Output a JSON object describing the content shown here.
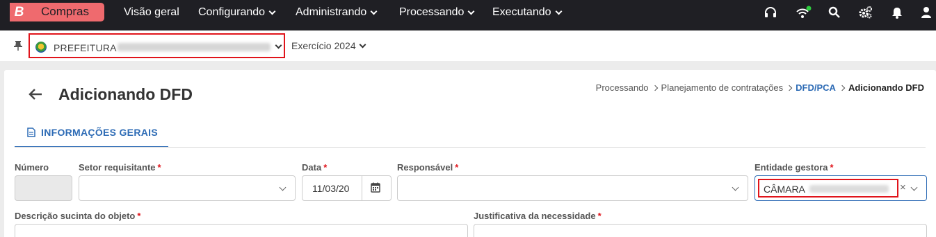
{
  "nav": {
    "brand_letter": "B",
    "brand_name": "Compras",
    "items": [
      {
        "label": "Visão geral"
      },
      {
        "label": "Configurando"
      },
      {
        "label": "Administrando"
      },
      {
        "label": "Processando"
      },
      {
        "label": "Executando"
      }
    ],
    "icons": [
      "headset-icon",
      "wifi-icon",
      "search-icon",
      "gears-icon",
      "bell-icon",
      "user-icon"
    ],
    "status_color": "#2ecc40"
  },
  "context": {
    "entity_label": "PREFEITURA",
    "exercise_label": "Exercício 2024"
  },
  "page": {
    "title": "Adicionando DFD",
    "breadcrumb": [
      "Processando",
      "Planejamento de contratações",
      "DFD/PCA",
      "Adicionando DFD"
    ],
    "tab_label": "INFORMAÇÕES GERAIS"
  },
  "form": {
    "numero_label": "Número",
    "setor_label": "Setor requisitante",
    "data_label": "Data",
    "data_value": "11/03/20",
    "responsavel_label": "Responsável",
    "entidade_label": "Entidade gestora",
    "entidade_value": "CÂMARA",
    "descricao_label": "Descrição sucinta do objeto",
    "justificativa_label": "Justificativa da necessidade",
    "required_mark": "*",
    "clear_symbol": "×"
  },
  "colors": {
    "topbar": "#1f1f24",
    "brand": "#ef6a6e",
    "accent": "#2d6bb5",
    "highlight": "#e0141b"
  }
}
